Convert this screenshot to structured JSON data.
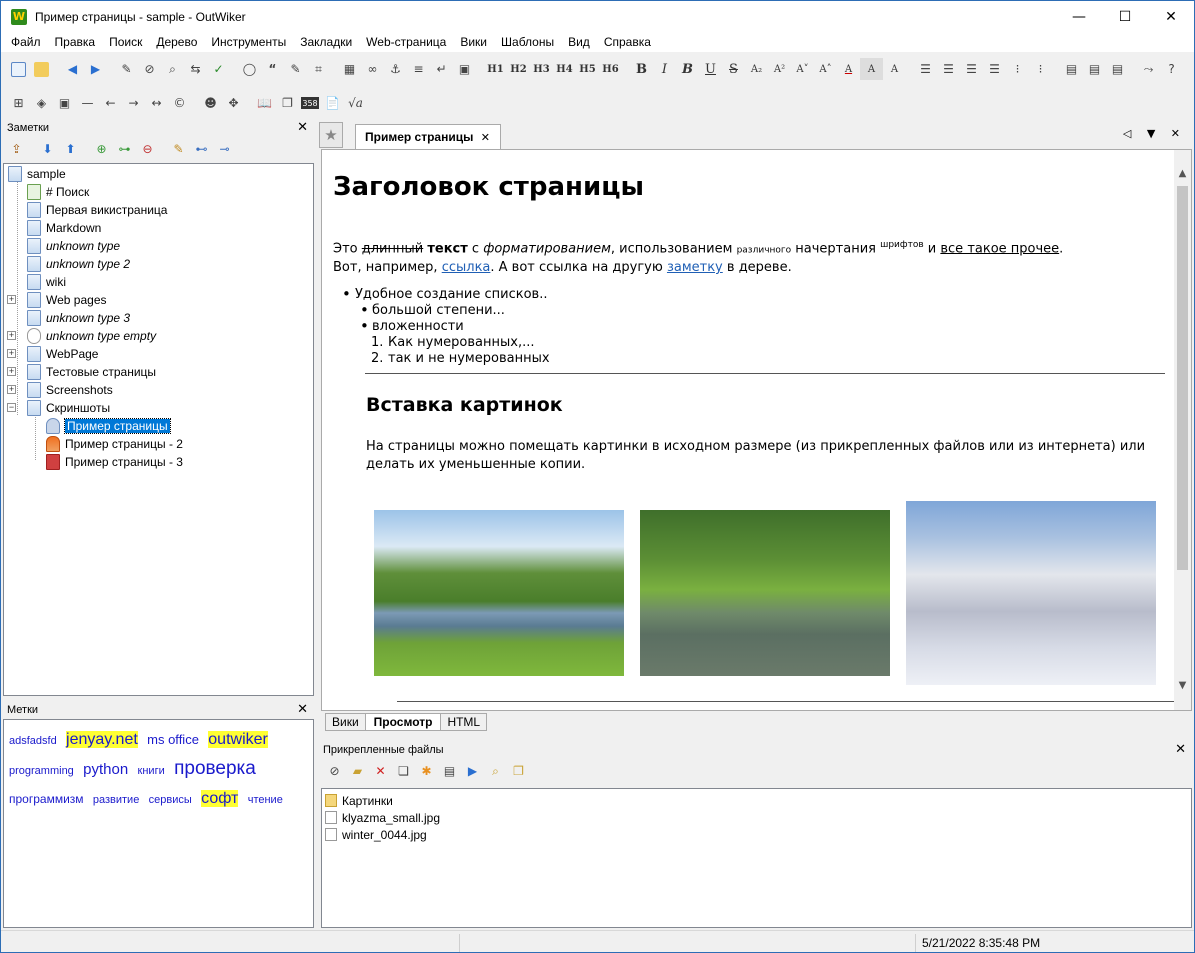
{
  "window": {
    "title": "Пример страницы - sample - OutWiker",
    "minimize": "—",
    "maximize": "☐",
    "close": "✕"
  },
  "menu": [
    "Файл",
    "Правка",
    "Поиск",
    "Дерево",
    "Инструменты",
    "Закладки",
    "Web-страница",
    "Вики",
    "Шаблоны",
    "Вид",
    "Справка"
  ],
  "toolbar1_headings": [
    "H1",
    "H2",
    "H3",
    "H4",
    "H5",
    "H6"
  ],
  "toolbar1_format": [
    "B",
    "I",
    "B",
    "U",
    "S",
    "A₂",
    "A²",
    "A˅",
    "A˄",
    "A",
    "A",
    "A"
  ],
  "toolbar2_extra": [
    "358",
    "√a"
  ],
  "notes_panel": {
    "title": "Заметки",
    "close": "✕"
  },
  "tree": {
    "root": "sample",
    "items": [
      {
        "label": "# Поиск",
        "italic": false
      },
      {
        "label": "Первая викистраница",
        "italic": false
      },
      {
        "label": "Markdown",
        "italic": false
      },
      {
        "label": "unknown type",
        "italic": true
      },
      {
        "label": "unknown type 2",
        "italic": true
      },
      {
        "label": "wiki",
        "italic": false
      },
      {
        "label": "Web pages",
        "italic": false,
        "expand": "+"
      },
      {
        "label": "unknown type 3",
        "italic": true
      },
      {
        "label": "unknown type empty",
        "italic": true,
        "expand": "+"
      },
      {
        "label": "WebPage",
        "italic": false,
        "expand": "+"
      },
      {
        "label": "Тестовые страницы",
        "italic": false,
        "expand": "+"
      },
      {
        "label": "Screenshots",
        "italic": false,
        "expand": "+"
      },
      {
        "label": "Скриншоты",
        "italic": false,
        "expand": "−"
      }
    ],
    "children": [
      "Пример страницы",
      "Пример страницы - 2",
      "Пример страницы - 3"
    ]
  },
  "tags_panel": {
    "title": "Метки",
    "close": "✕"
  },
  "tags": [
    {
      "text": "adsfadsfd",
      "size": 11,
      "hl": false
    },
    {
      "text": "jenyay.net",
      "size": 16,
      "hl": true
    },
    {
      "text": "ms office",
      "size": 13,
      "hl": false
    },
    {
      "text": "outwiker",
      "size": 16,
      "hl": true
    },
    {
      "text": "programming",
      "size": 11,
      "hl": false
    },
    {
      "text": "python",
      "size": 15,
      "hl": false
    },
    {
      "text": "книги",
      "size": 11,
      "hl": false
    },
    {
      "text": "проверка",
      "size": 19,
      "hl": false
    },
    {
      "text": "программизм",
      "size": 12,
      "hl": false
    },
    {
      "text": "развитие",
      "size": 11,
      "hl": false
    },
    {
      "text": "сервисы",
      "size": 11,
      "hl": false
    },
    {
      "text": "софт",
      "size": 16,
      "hl": true
    },
    {
      "text": "чтение",
      "size": 11,
      "hl": false
    }
  ],
  "tab": {
    "label": "Пример страницы",
    "close": "✕",
    "controls": "◁ ▼ ✕"
  },
  "page": {
    "h1": "Заголовок страницы",
    "p1": {
      "t1": "Это ",
      "strike": "длинный",
      "t2": " ",
      "bold": "текст",
      "t3": " с ",
      "italic": "форматированием",
      "t4": ", использованием ",
      "small": "различного",
      "t5": " начертания ",
      "sup": "шрифтов",
      "t6": " и ",
      "underline": "все такое прочее",
      "t7": "."
    },
    "p2": {
      "t1": "Вот, например, ",
      "link1": "ссылка",
      "t2": ". А вот ссылка на другую ",
      "link2": "заметку",
      "t3": " в дереве."
    },
    "list": {
      "item1": "Удобное создание списков..",
      "item2": "большой степени...",
      "item3": "вложенности",
      "num1": "Как нумерованных,...",
      "num2": "так и не нумерованных",
      "num1_marker": "1.",
      "num2_marker": "2."
    },
    "h2": "Вставка картинок",
    "p3": "На страницы можно помещать картинки в исходном размере (из прикрепленных файлов или из интернета) или делать их уменьшенные копии."
  },
  "view_tabs": [
    "Вики",
    "Просмотр",
    "HTML"
  ],
  "attachments": {
    "title": "Прикрепленные файлы",
    "close": "✕",
    "files": [
      {
        "name": "Картинки",
        "type": "folder"
      },
      {
        "name": "klyazma_small.jpg",
        "type": "file"
      },
      {
        "name": "winter_0044.jpg",
        "type": "file"
      }
    ]
  },
  "status": {
    "datetime": "5/21/2022 8:35:48 PM"
  },
  "colors": {
    "accent": "#0078d7",
    "link": "#1f5fb5",
    "tag_highlight": "#ffff33",
    "tag_text": "#1a1acc"
  }
}
